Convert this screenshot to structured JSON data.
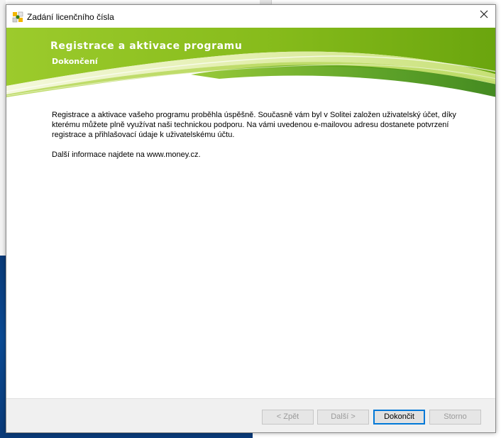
{
  "window": {
    "title": "Zadání licenčního čísla",
    "app_icon": "money-app-icon",
    "close_icon": "close-icon"
  },
  "banner": {
    "title": "Registrace a aktivace programu",
    "subtitle": "Dokončení",
    "accent_color": "#8cbf1f"
  },
  "content": {
    "paragraph1": "Registrace a aktivace vašeho programu proběhla úspěšně. Současně vám byl v Solitei založen uživatelský účet, díky kterému můžete plně využívat naši technickou podporu. Na vámi uvedenou e-mailovou adresu dostanete potvrzení registrace a přihlašovací údaje k uživatelskému účtu.",
    "paragraph2": "Další informace najdete na www.money.cz."
  },
  "footer": {
    "back_label": "< Zpět",
    "next_label": "Další >",
    "finish_label": "Dokončit",
    "cancel_label": "Storno",
    "back_enabled": false,
    "next_enabled": false,
    "finish_enabled": true,
    "cancel_enabled": false
  },
  "colors": {
    "desktop_blue": "#0b4b94",
    "default_button_border": "#0078d7"
  }
}
